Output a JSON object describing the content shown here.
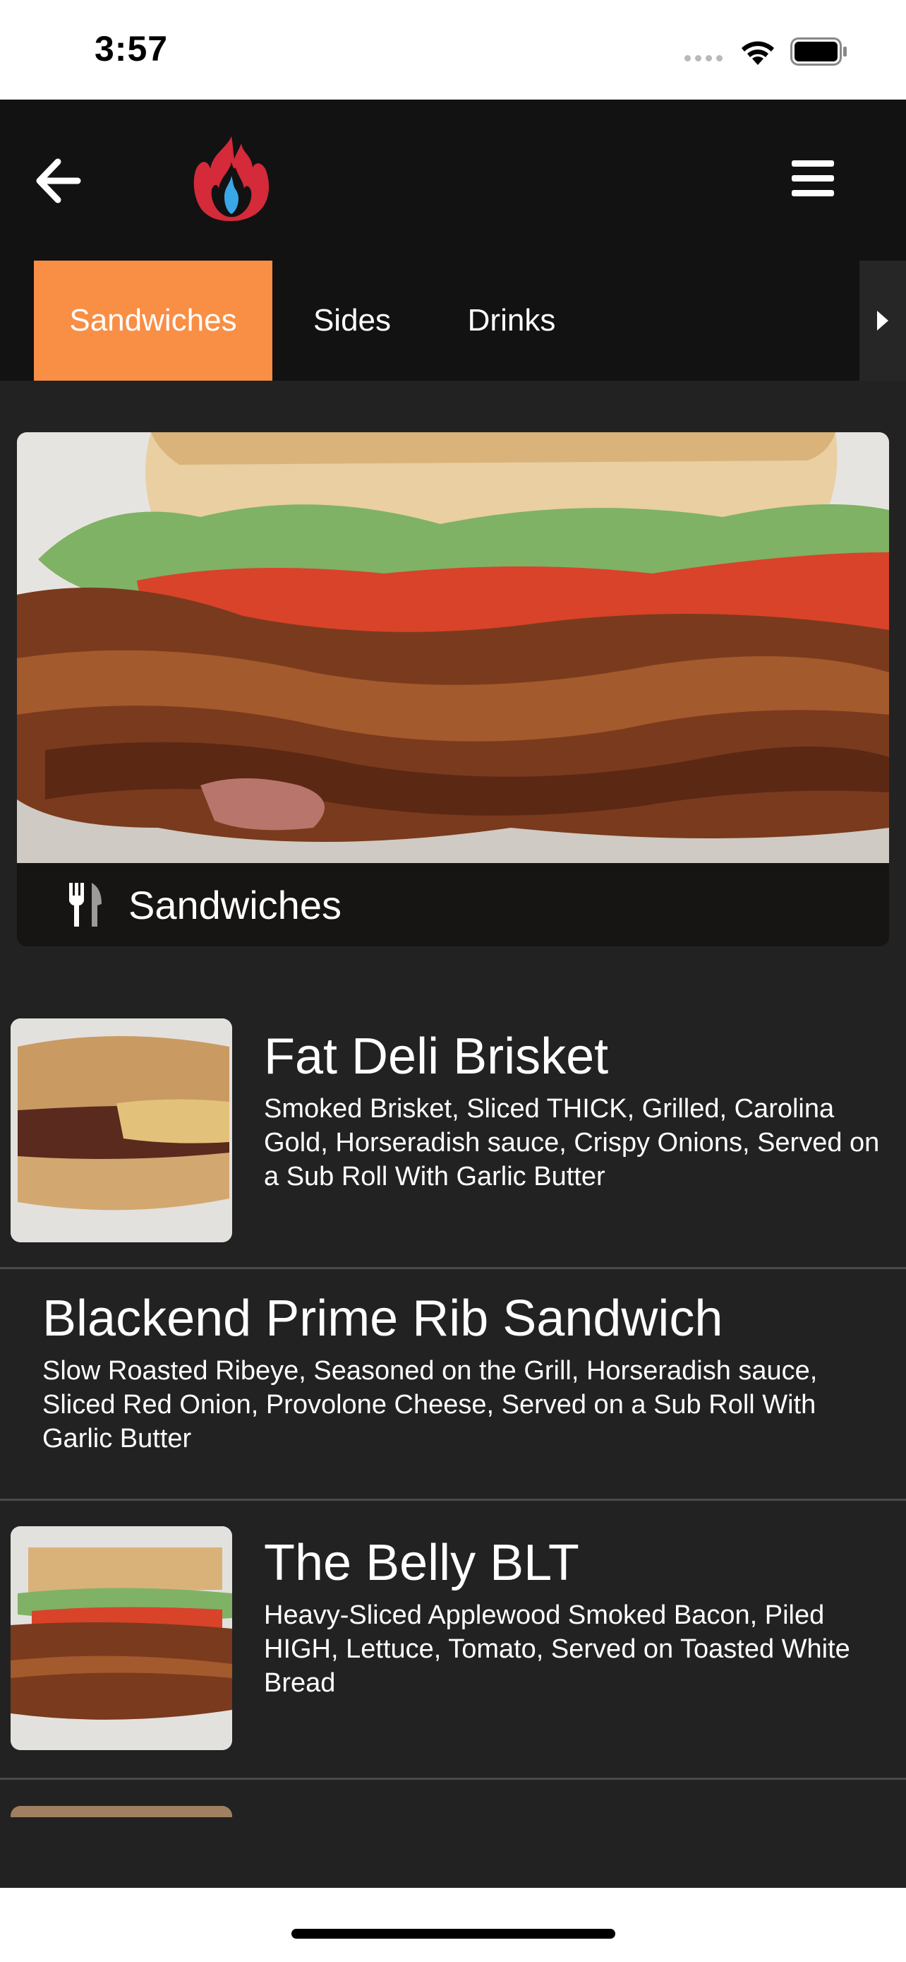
{
  "status_bar": {
    "time": "3:57"
  },
  "header": {
    "logo": "flame-logo",
    "back_icon": "arrow-left-icon",
    "menu_icon": "hamburger-icon"
  },
  "tabs": [
    {
      "label": "Sandwiches",
      "active": true
    },
    {
      "label": "Sides",
      "active": false
    },
    {
      "label": "Drinks",
      "active": false
    }
  ],
  "category": {
    "title": "Sandwiches",
    "icon": "utensils-icon"
  },
  "menu_items": [
    {
      "name": "Fat Deli Brisket",
      "description": "Smoked Brisket, Sliced THICK, Grilled, Carolina Gold, Horseradish sauce, Crispy Onions, Served on a Sub Roll With Garlic Butter"
    },
    {
      "name": "Blackend Prime Rib Sandwich",
      "description": "Slow Roasted Ribeye, Seasoned on the Grill, Horseradish sauce, Sliced Red Onion, Provolone Cheese, Served on a Sub Roll With Garlic Butter"
    },
    {
      "name": "The Belly BLT",
      "description": "Heavy-Sliced Applewood Smoked Bacon, Piled HIGH, Lettuce, Tomato, Served on Toasted White Bread"
    }
  ],
  "colors": {
    "accent": "#f98e45",
    "header_bg": "#121212",
    "page_bg": "#222223"
  }
}
